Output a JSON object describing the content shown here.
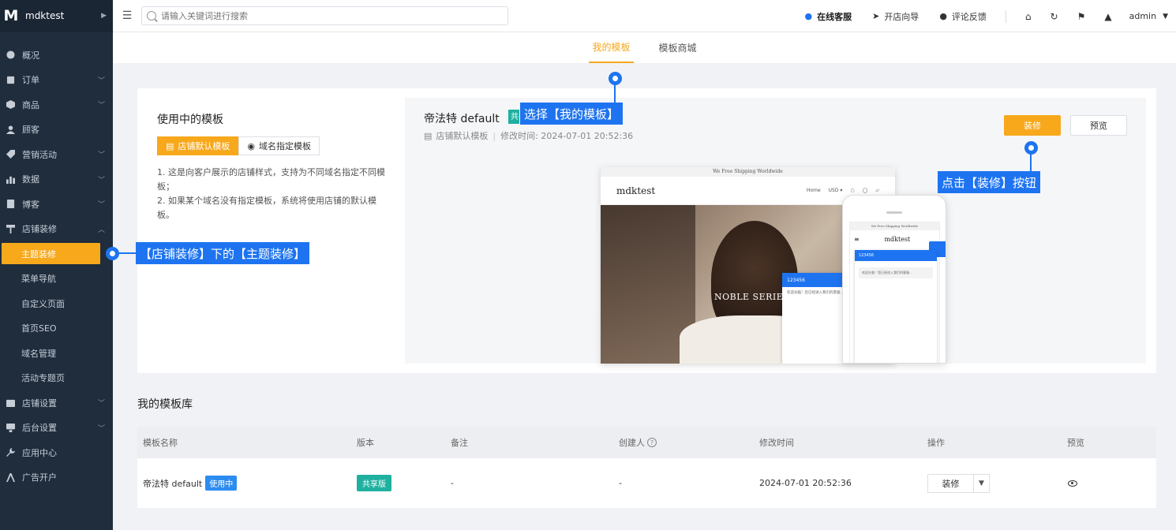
{
  "brand": {
    "logo": "M",
    "name": "mdktest"
  },
  "sidebar": {
    "items": [
      {
        "label": "概况",
        "icon": "gauge-icon",
        "has_children": false
      },
      {
        "label": "订单",
        "icon": "order-icon",
        "has_children": true
      },
      {
        "label": "商品",
        "icon": "box-icon",
        "has_children": true
      },
      {
        "label": "顾客",
        "icon": "user-icon",
        "has_children": false
      },
      {
        "label": "营销活动",
        "icon": "tag-icon",
        "has_children": true
      },
      {
        "label": "数据",
        "icon": "chart-icon",
        "has_children": true
      },
      {
        "label": "博客",
        "icon": "blog-icon",
        "has_children": true
      },
      {
        "label": "店铺装修",
        "icon": "brush-icon",
        "has_children": true,
        "expanded": true
      }
    ],
    "sub_items": [
      {
        "label": "主题装修",
        "active": true
      },
      {
        "label": "菜单导航"
      },
      {
        "label": "自定义页面"
      },
      {
        "label": "首页SEO"
      },
      {
        "label": "域名管理"
      },
      {
        "label": "活动专题页"
      }
    ],
    "bottom_items": [
      {
        "label": "店铺设置",
        "icon": "store-icon",
        "has_children": true
      },
      {
        "label": "后台设置",
        "icon": "monitor-icon",
        "has_children": true
      },
      {
        "label": "应用中心",
        "icon": "wrench-icon",
        "has_children": false
      },
      {
        "label": "广告开户",
        "icon": "ads-icon",
        "has_children": false
      }
    ]
  },
  "topbar": {
    "search_placeholder": "请输入关键词进行搜索",
    "service": "在线客服",
    "guide": "开店向导",
    "feedback": "评论反馈",
    "user": "admin"
  },
  "tabs": [
    {
      "label": "我的模板",
      "active": true
    },
    {
      "label": "模板商城",
      "active": false
    }
  ],
  "in_use": {
    "title": "使用中的模板",
    "seg_default": "店铺默认模板",
    "seg_domain": "域名指定模板",
    "note1": "1. 这是向客户展示的店铺样式，支持为不同域名指定不同模板；",
    "note2": "2. 如果某个域名没有指定模板，系统将使用店铺的默认模板。"
  },
  "current_template": {
    "name": "帝法特 default",
    "badge": "共",
    "type": "店铺默认模板",
    "modified": "修改时间: 2024-07-01 20:52:36",
    "decorate_button": "装修",
    "preview_button": "预览"
  },
  "mock_site": {
    "topbar_text": "We Free Shipping Worldwide",
    "store": "mdktest",
    "nav_home": "Home",
    "currency": "USD ▾",
    "hero_text": "NOBLE SERIES",
    "chat_name": "123456",
    "chat_text": "欢迎光临！您已经进入我们的客服…"
  },
  "callouts": {
    "my_templates": "选择【我的模板】",
    "decorate": "点击【装修】按钮",
    "theme": "【店铺装修】下的【主题装修】"
  },
  "library": {
    "title": "我的模板库",
    "headers": [
      "模板名称",
      "版本",
      "备注",
      "创建人",
      "修改时间",
      "操作",
      "预览"
    ],
    "rows": [
      {
        "name": "帝法特 default",
        "status": "使用中",
        "version": "共享版",
        "note": "-",
        "creator": "-",
        "modified": "2024-07-01 20:52:36",
        "action": "装修"
      }
    ]
  },
  "colors": {
    "accent": "#f7a81b",
    "sidebar": "#1f2d3d",
    "callout": "#1e74f0",
    "teal": "#1fb0a0"
  }
}
